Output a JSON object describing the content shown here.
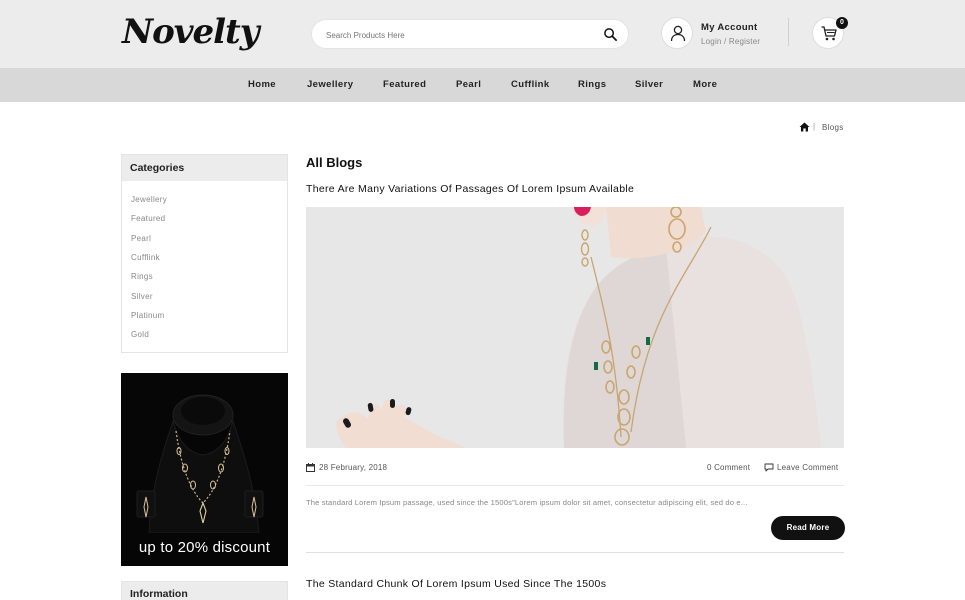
{
  "header": {
    "logo": "Novelty",
    "search_placeholder": "Search Products Here",
    "account_title": "My Account",
    "account_sub": "Login / Register",
    "cart_count": "0"
  },
  "nav": {
    "items": [
      "Home",
      "Jewellery",
      "Featured",
      "Pearl",
      "Cufflink",
      "Rings",
      "Silver",
      "More"
    ]
  },
  "breadcrumb": {
    "current": "Blogs",
    "separator": "|"
  },
  "sidebar": {
    "categories_title": "Categories",
    "categories": [
      "Jewellery",
      "Featured",
      "Pearl",
      "Cufflink",
      "Rings",
      "Silver",
      "Platinum",
      "Gold"
    ],
    "promo_text": "up to 20% discount",
    "information_title": "Information"
  },
  "main": {
    "page_title": "All Blogs",
    "posts": [
      {
        "title": "There Are Many Variations Of Passages Of Lorem Ipsum Available",
        "date": "28 February, 2018",
        "comments": "0 Comment",
        "leave_comment": "Leave Comment",
        "excerpt": "The standard Lorem Ipsum passage, used since the 1500s\"Lorem ipsum dolor sit amet, consectetur adipiscing elit, sed do e...",
        "read_more": "Read More"
      },
      {
        "title": "The Standard Chunk Of Lorem Ipsum Used Since The 1500s"
      }
    ]
  },
  "colors": {
    "header_bg": "#ececec",
    "nav_bg": "#d8d8d8",
    "accent_dark": "#111111",
    "promo_bg": "#060606"
  },
  "icons": [
    "search-icon",
    "user-icon",
    "cart-icon",
    "home-icon",
    "calendar-icon",
    "comment-icon"
  ]
}
